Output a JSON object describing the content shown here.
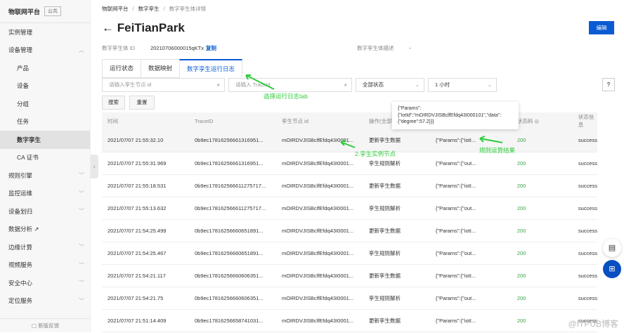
{
  "sidebar": {
    "logo": "物联网平台",
    "badge": "公共",
    "items": [
      {
        "label": "实例管理",
        "sub": false
      },
      {
        "label": "设备管理",
        "sub": false,
        "chev": "up"
      },
      {
        "label": "产品",
        "sub": true
      },
      {
        "label": "设备",
        "sub": true
      },
      {
        "label": "分组",
        "sub": true
      },
      {
        "label": "任务",
        "sub": true
      },
      {
        "label": "数字孪生",
        "sub": true,
        "active": true
      },
      {
        "label": "CA 证书",
        "sub": true
      },
      {
        "label": "规则引擎",
        "chev": "down"
      },
      {
        "label": "监控运维",
        "chev": "down"
      },
      {
        "label": "设备划归",
        "chev": "down"
      },
      {
        "label": "数据分析 ↗"
      },
      {
        "label": "边缘计算",
        "chev": "down"
      },
      {
        "label": "视频服务",
        "chev": "down"
      },
      {
        "label": "安全中心",
        "chev": "down"
      },
      {
        "label": "定位服务",
        "chev": "down"
      }
    ],
    "feedback": "新版反馈"
  },
  "breadcrumb": [
    "物联网平台",
    "数字孪生",
    "数字孪生体详情"
  ],
  "header": {
    "title": "FeiTianPark",
    "edit": "编辑"
  },
  "meta": {
    "id_label": "数字孪生体 ID",
    "id_value": "20210706000015qKTx",
    "copy": "复制",
    "desc_label": "数字孪生体描述",
    "desc_value": "-"
  },
  "tabs": [
    "运行状态",
    "数据映射",
    "数字孪生运行日志"
  ],
  "filters": {
    "node_placeholder": "请输入孪生节点 id",
    "trace_placeholder": "请输入 TraceId",
    "status": "全部状态",
    "range": "1 小时",
    "search": "搜索",
    "reset": "重置",
    "help": "?"
  },
  "table": {
    "headers": [
      "时间",
      "TraceID",
      "孪生节点 id",
      "操作(全部)",
      "运算结果",
      "状态码",
      "状态信息"
    ],
    "rows": [
      [
        "2021/07/07 21:55:32.10",
        "0b9ec17816256661316951...",
        "mOIRDVJISBclfEfdq43I0001...",
        "更新孪生数据",
        "{\"Params\":{\"iotI...",
        "200",
        "success"
      ],
      [
        "2021/07/07 21:55:31.969",
        "0b9ec17816256661316951...",
        "mOIRDVJISBclfEfdq43I0001...",
        "孪生规则解析",
        "{\"Params\":{\"out...",
        "200",
        "success"
      ],
      [
        "2021/07/07 21:55:18.531",
        "0b9ec178162566611275717...",
        "mOIRDVJISBclfEfdq43I0001...",
        "更新孪生数据",
        "{\"Params\":{\"iotI...",
        "200",
        "success"
      ],
      [
        "2021/07/07 21:55:13.632",
        "0b9ec178162566611275717...",
        "mOIRDVJISBclfEfdq43I0001...",
        "孪生规则解析",
        "{\"Params\":{\"out...",
        "200",
        "success"
      ],
      [
        "2021/07/07 21:54:25.499",
        "0b9ec17816256660651891...",
        "mOIRDVJISBclfEfdq43I0001...",
        "更新孪生数据",
        "{\"Params\":{\"iotI...",
        "200",
        "success"
      ],
      [
        "2021/07/07 21:54:25.467",
        "0b9ec17816256660651891...",
        "mOIRDVJISBclfEfdq43I0001...",
        "孪生规则解析",
        "{\"Params\":{\"out...",
        "200",
        "success"
      ],
      [
        "2021/07/07 21:54:21.117",
        "0b9ec17816256660606351...",
        "mOIRDVJISBclfEfdq43I0001...",
        "更新孪生数据",
        "{\"Params\":{\"iotI...",
        "200",
        "success"
      ],
      [
        "2021/07/07 21:54:21.75",
        "0b9ec17816256660606351...",
        "mOIRDVJISBclfEfdq43I0001...",
        "孪生规则解析",
        "{\"Params\":{\"out...",
        "200",
        "success"
      ],
      [
        "2021/07/07 21:51:14.409",
        "0b9ec17816256658741031...",
        "mOIRDVJISBclfEfdq43I0001...",
        "更新孪生数据",
        "{\"Params\":{\"iotI...",
        "200",
        "success"
      ]
    ]
  },
  "tooltip": "{\"Params\":{\"iotId\":\"mOIRDVJISBclfEfdq43I000101\",\"data\":{\"degree\":57.2}}}",
  "annotations": {
    "tab": "选择运行日志tab",
    "node": "2.孪生实例节点",
    "result": "规则运算结果"
  },
  "watermark": "@ITPUB博客",
  "colors": {
    "primary": "#0a5bd3",
    "success": "#3aa545",
    "annotation": "#2ecc3a"
  }
}
